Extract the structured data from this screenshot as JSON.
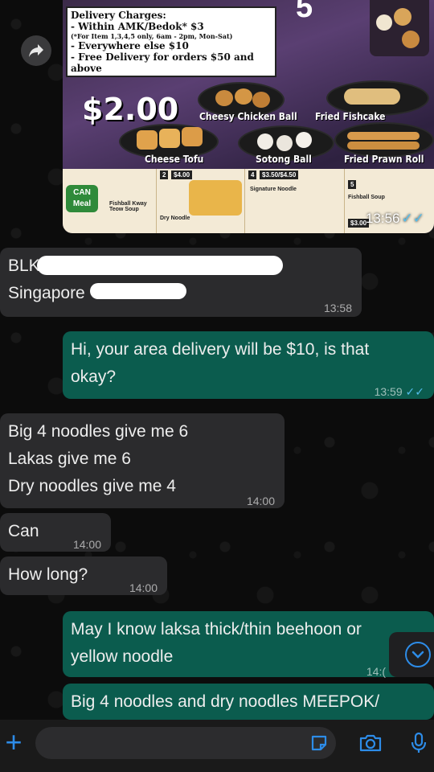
{
  "colors": {
    "incoming_bubble": "#2b2b2d",
    "outgoing_bubble": "#0b5c4e",
    "accent": "#2d8ce8",
    "read_ticks": "#53bdeb"
  },
  "image_message": {
    "charges_title": "Delivery Charges:",
    "charges_line1": "- Within AMK/Bedok* $3",
    "charges_note": "(*For Item 1,3,4,5 only, 6am - 2pm, Mon-Sat)",
    "charges_line2": "- Everywhere else $10",
    "charges_line3": "- Free Delivery for orders $50 and above",
    "big_price": "$2.00",
    "items": [
      "Cheesy Chicken Ball",
      "Fried Fishcake",
      "Cheese Tofu",
      "Sotong Ball",
      "Fried Prawn Roll"
    ],
    "strip_tags": [
      "2",
      "$4.00",
      "4",
      "$3.50/$4.50",
      "5",
      "$3.00"
    ],
    "strip_labels": [
      "Fishball Kway Teow Soup",
      "Dry Noodle",
      "Signature Noodle",
      "Fishball Soup"
    ],
    "can_meal": "CAN Meal",
    "time": "13:56"
  },
  "messages": [
    {
      "id": "m1",
      "dir": "in",
      "line1": "BLK",
      "line2": "Singapore",
      "time": "13:58"
    },
    {
      "id": "m2",
      "dir": "out",
      "line1": "Hi, your area delivery will be $10, is that",
      "line2": "okay?",
      "time": "13:59"
    },
    {
      "id": "m3",
      "dir": "in",
      "line1": "Big 4 noodles give me 6",
      "line2": "Lakas give me 6",
      "line3": "Dry noodles give me 4",
      "time": "14:00"
    },
    {
      "id": "m4",
      "dir": "in",
      "line1": "Can",
      "time": "14:00"
    },
    {
      "id": "m5",
      "dir": "in",
      "line1": "How long?",
      "time": "14:00"
    },
    {
      "id": "m6",
      "dir": "out",
      "line1": "May I know laksa thick/thin beehoon or",
      "line2": "yellow noodle",
      "time": "14:("
    },
    {
      "id": "m7",
      "dir": "out",
      "line1": "Big 4 noodles and dry noodles MEEPOK/"
    }
  ],
  "input": {
    "value": "",
    "placeholder": ""
  },
  "icons": [
    "forward-icon",
    "chevron-down-icon",
    "plus-icon",
    "sticker-icon",
    "camera-icon",
    "microphone-icon",
    "double-check-icon"
  ]
}
